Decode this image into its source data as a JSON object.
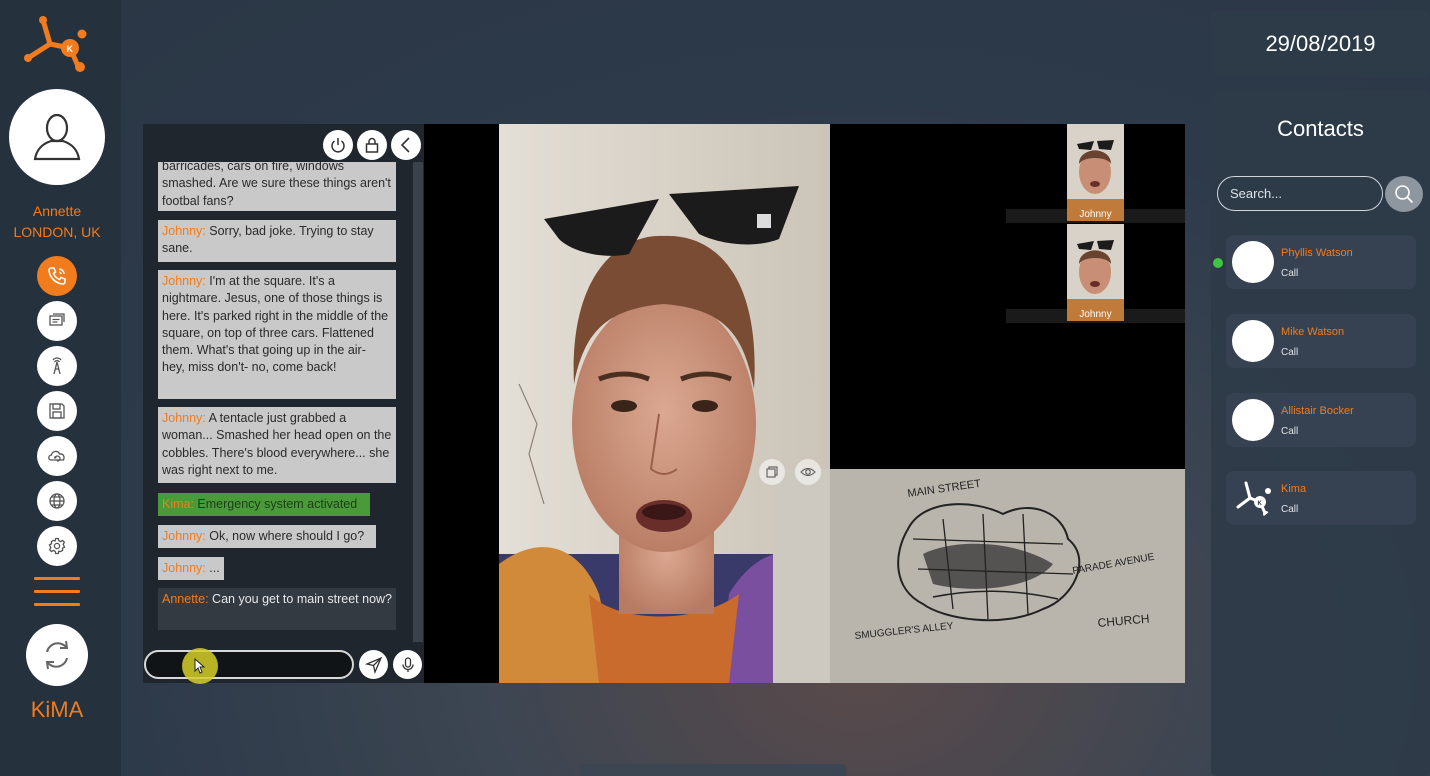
{
  "user": {
    "name": "Annette",
    "location": "LONDON, UK"
  },
  "brand": "KiMA",
  "nav": [
    {
      "id": "calls",
      "icon": "phone-icon",
      "active": true
    },
    {
      "id": "messages",
      "icon": "chat-icon",
      "active": false
    },
    {
      "id": "broadcast",
      "icon": "antenna-icon",
      "active": false
    },
    {
      "id": "save",
      "icon": "floppy-disk-icon",
      "active": false
    },
    {
      "id": "cloud",
      "icon": "cloud-sync-icon",
      "active": false
    },
    {
      "id": "web",
      "icon": "globe-icon",
      "active": false
    },
    {
      "id": "settings",
      "icon": "gear-icon",
      "active": false
    }
  ],
  "chat": {
    "messages": [
      {
        "from": "",
        "text": "barricades, cars on fire, windows smashed.  Are we sure these things aren't footbal fans?"
      },
      {
        "from": "Johnny:",
        "text": " Sorry, bad joke. Trying to stay sane."
      },
      {
        "from": "Johnny:",
        "text": " I'm at the square.  It's a nightmare.  Jesus, one of those things is here. It's parked right in the middle of the square, on top of three cars. Flattened them.  What's that going up in the air- hey, miss don't- no, come back!"
      },
      {
        "from": "Johnny:",
        "text": " A tentacle just grabbed a woman... Smashed her head open on the cobbles.  There's blood everywhere... she was right next to me."
      },
      {
        "from": "Kima:",
        "text": " Emergency system activated"
      },
      {
        "from": "Johnny:",
        "text": " Ok, now where should I go?"
      },
      {
        "from": "Johnny:",
        "text": " ..."
      },
      {
        "from": "Annette:",
        "text": " Can you get to main street now?"
      }
    ],
    "input_value": ""
  },
  "video": {
    "thumbnails": [
      {
        "label": "Johnny"
      },
      {
        "label": "Johnny"
      }
    ],
    "map_labels": [
      "MAIN STREET",
      "PARADE AVENUE",
      "CHURCH",
      "SMUGGLER'S ALLEY"
    ]
  },
  "date": "29/08/2019",
  "contacts": {
    "title": "Contacts",
    "search_placeholder": "Search...",
    "items": [
      {
        "name": "Phyllis Watson",
        "action": "Call",
        "online": true,
        "avatar": "blank"
      },
      {
        "name": "Mike Watson",
        "action": "Call",
        "online": false,
        "avatar": "blank"
      },
      {
        "name": "Allistair Bocker",
        "action": "Call",
        "online": false,
        "avatar": "blank"
      },
      {
        "name": "Kima",
        "action": "Call",
        "online": false,
        "avatar": "kima-logo"
      }
    ]
  },
  "colors": {
    "accent": "#f07c1e",
    "system_message": "#4a9a3a",
    "online": "#3ec43e"
  }
}
